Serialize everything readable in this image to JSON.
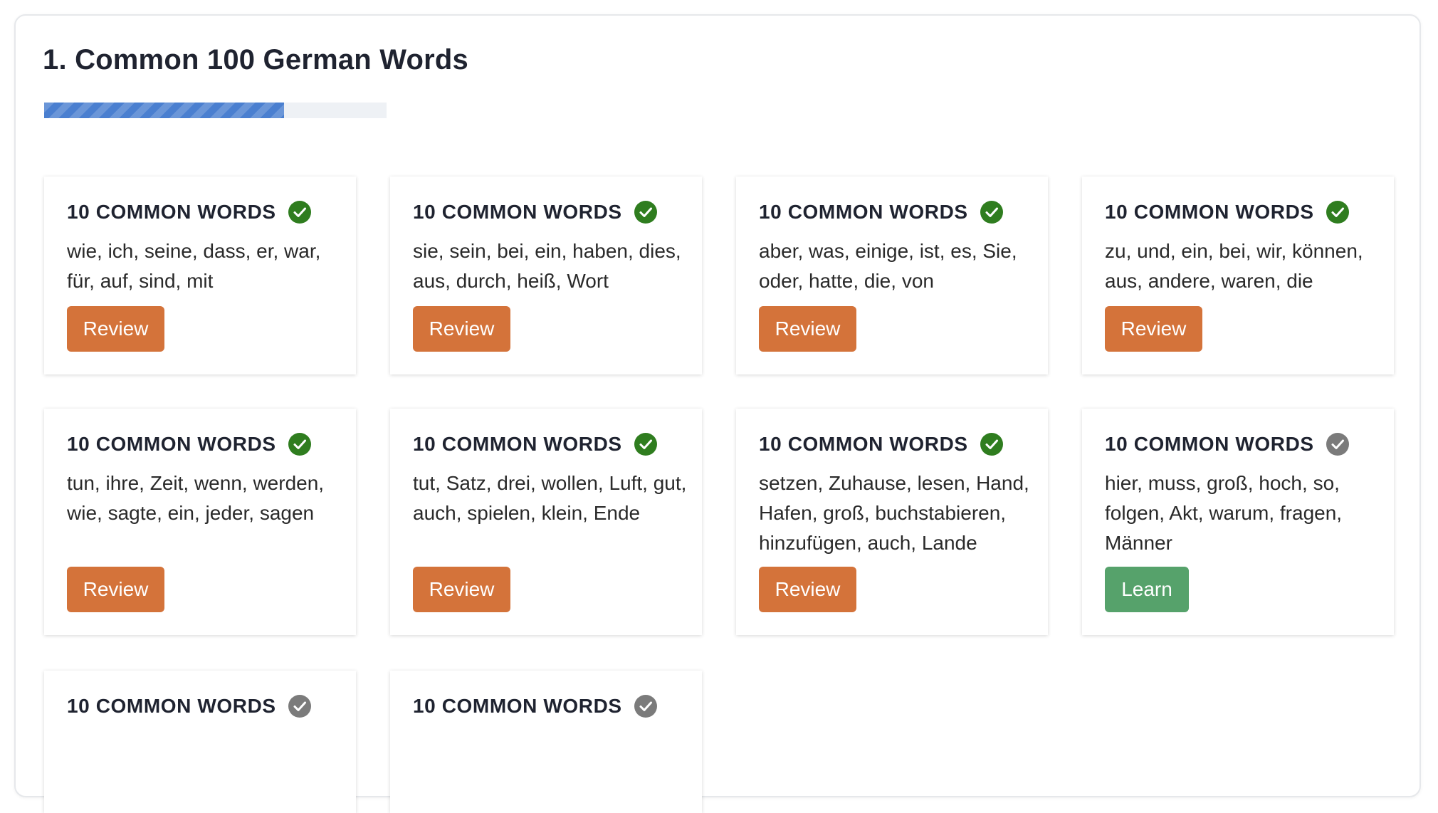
{
  "section": {
    "title": "1. Common 100 German Words",
    "progress": 0.7
  },
  "colors": {
    "done_check": "#2f7d1f",
    "pending_check": "#7b7b7b",
    "review_button": "#d4733a",
    "learn_button": "#56a26b",
    "progress_fill": "#4a7fd0"
  },
  "cards": [
    {
      "title": "10 COMMON WORDS",
      "status": "done",
      "words": "wie, ich, seine, dass, er, war, für, auf, sind, mit",
      "button": "Review"
    },
    {
      "title": "10 COMMON WORDS",
      "status": "done",
      "words": "sie, sein, bei, ein, haben, dies, aus, durch, heiß, Wort",
      "button": "Review"
    },
    {
      "title": "10 COMMON WORDS",
      "status": "done",
      "words": "aber, was, einige, ist, es, Sie, oder, hatte, die, von",
      "button": "Review"
    },
    {
      "title": "10 COMMON WORDS",
      "status": "done",
      "words": "zu, und, ein, bei, wir, können, aus, andere, waren, die",
      "button": "Review"
    },
    {
      "title": "10 COMMON WORDS",
      "status": "done",
      "words": "tun, ihre, Zeit, wenn, werden, wie, sagte, ein, jeder, sagen",
      "button": "Review"
    },
    {
      "title": "10 COMMON WORDS",
      "status": "done",
      "words": "tut, Satz, drei, wollen, Luft, gut, auch, spielen, klein, Ende",
      "button": "Review"
    },
    {
      "title": "10 COMMON WORDS",
      "status": "done",
      "words": "setzen, Zuhause, lesen, Hand, Hafen, groß, buchstabieren, hinzufügen, auch, Lande",
      "button": "Review"
    },
    {
      "title": "10 COMMON WORDS",
      "status": "pending",
      "words": "hier, muss, groß, hoch, so, folgen, Akt, warum, fragen, Männer",
      "button": "Learn"
    },
    {
      "title": "10 COMMON WORDS",
      "status": "pending"
    },
    {
      "title": "10 COMMON WORDS",
      "status": "pending"
    }
  ]
}
